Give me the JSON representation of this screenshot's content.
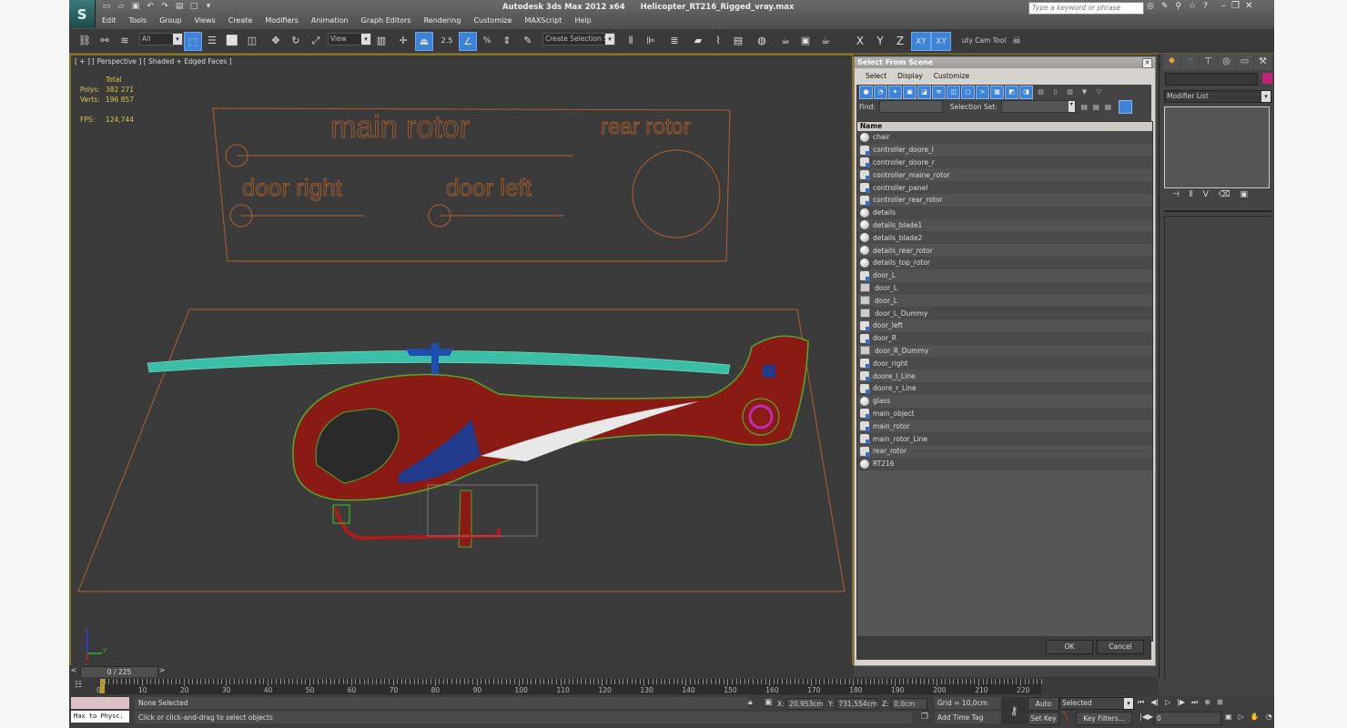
{
  "app": {
    "title": "Autodesk 3ds Max  2012 x64",
    "file": "Helicopter_RT216_Rigged_vray.max",
    "logo_icon": "3dsmax-logo-icon",
    "search_placeholder": "Type a keyword or phrase",
    "menu": [
      "Edit",
      "Tools",
      "Group",
      "Views",
      "Create",
      "Modifiers",
      "Animation",
      "Graph Editors",
      "Rendering",
      "Customize",
      "MAXScript",
      "Help"
    ]
  },
  "toolbar": {
    "selection_filter": "All",
    "ref_coord": "View",
    "snap_angle": "2.5",
    "named_selection_placeholder": "Create Selection Se",
    "axis_x": "X",
    "axis_y": "Y",
    "axis_z": "Z",
    "axis_xy": "XY",
    "axis_xy2": "XY",
    "cam_tool": "uty Cam Tool"
  },
  "viewport": {
    "label": "[ + ] [ Perspective ] [ Shaded + Edged Faces ]",
    "stats": {
      "header": "Total",
      "polys_label": "Polys:",
      "polys": "382 271",
      "verts_label": "Verts:",
      "verts": "196 857",
      "fps_label": "FPS:",
      "fps": "124,744"
    },
    "panel_labels": {
      "main_rotor": "main rotor",
      "rear_rotor": "rear rotor",
      "door_right": "door right",
      "door_left": "door left"
    },
    "axis": {
      "z": "z",
      "y": "y",
      "x": "x"
    }
  },
  "select_dialog": {
    "title": "Select From Scene",
    "menu": [
      "Select",
      "Display",
      "Customize"
    ],
    "find_label": "Find:",
    "find_value": "",
    "selection_set_label": "Selection Set:",
    "selection_set_value": "",
    "column_name": "Name",
    "objects": [
      {
        "name": "chair",
        "type": "geometry"
      },
      {
        "name": "controller_doore_l",
        "type": "shape"
      },
      {
        "name": "controller_doore_r",
        "type": "shape"
      },
      {
        "name": "controller_maine_rotor",
        "type": "shape"
      },
      {
        "name": "controller_panel",
        "type": "shape"
      },
      {
        "name": "controller_rear_rotor",
        "type": "shape"
      },
      {
        "name": "details",
        "type": "geometry"
      },
      {
        "name": "details_blade1",
        "type": "geometry"
      },
      {
        "name": "details_blade2",
        "type": "geometry"
      },
      {
        "name": "details_rear_rotor",
        "type": "geometry"
      },
      {
        "name": "details_top_rotor",
        "type": "geometry"
      },
      {
        "name": "door_L",
        "type": "shape"
      },
      {
        "name": "door_L",
        "type": "helper"
      },
      {
        "name": "door_L",
        "type": "helper"
      },
      {
        "name": "door_L_Dummy",
        "type": "helper"
      },
      {
        "name": "door_left",
        "type": "shape"
      },
      {
        "name": "door_R",
        "type": "shape"
      },
      {
        "name": "door_R_Dummy",
        "type": "helper"
      },
      {
        "name": "door_right",
        "type": "shape"
      },
      {
        "name": "doore_l_Line",
        "type": "shape"
      },
      {
        "name": "doore_r_Line",
        "type": "shape"
      },
      {
        "name": "glass",
        "type": "geometry"
      },
      {
        "name": "main_object",
        "type": "shape"
      },
      {
        "name": "main_rotor",
        "type": "shape"
      },
      {
        "name": "main_rotor_Line",
        "type": "shape"
      },
      {
        "name": "rear_rotor",
        "type": "shape"
      },
      {
        "name": "RT216",
        "type": "geometry"
      }
    ],
    "ok_label": "OK",
    "cancel_label": "Cancel"
  },
  "command_panel": {
    "tabs": [
      "create-icon",
      "modify-icon",
      "hierarchy-icon",
      "motion-icon",
      "display-icon",
      "utilities-icon"
    ],
    "object_color": "#c1237a",
    "modifier_list": "Modifier List"
  },
  "timeline": {
    "frame_display": "0 / 225",
    "current_frame": 0,
    "total_frames": 225,
    "ticks": [
      "0",
      "10",
      "20",
      "30",
      "40",
      "50",
      "60",
      "70",
      "80",
      "90",
      "100",
      "110",
      "120",
      "130",
      "140",
      "150",
      "160",
      "170",
      "180",
      "190",
      "200",
      "210",
      "220"
    ]
  },
  "status": {
    "maxscript_label": "Max to Physc.",
    "selection": "None Selected",
    "prompt": "Click or click-and-drag to select objects",
    "x_label": "X:",
    "x": "20,953cm",
    "y_label": "Y:",
    "y": "731,554cm",
    "z_label": "Z:",
    "z": "0,0cm",
    "grid": "Grid = 10,0cm",
    "add_time_tag": "Add Time Tag",
    "auto_key": "Auto Key",
    "set_key": "Set Key",
    "key_mode": "Selected",
    "key_filters": "Key Filters...",
    "frame_field": "0"
  },
  "colors": {
    "accent_blue": "#3d83d8",
    "viewport_border": "#857126",
    "wire_orange": "#b0602a",
    "stats_yellow": "#d9c64a"
  }
}
